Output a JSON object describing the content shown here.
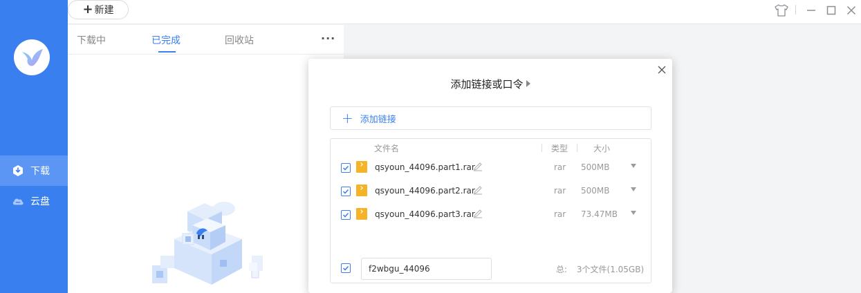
{
  "colors": {
    "accent": "#3a7ff0",
    "sidebar": "#3a7ff0",
    "folder_icon": "#f5b428"
  },
  "sidebar": {
    "logo_icon": "hummingbird-logo-icon",
    "items": [
      {
        "label": "下载",
        "icon": "download-icon",
        "active": true
      },
      {
        "label": "云盘",
        "icon": "cloud-icon",
        "active": false
      }
    ]
  },
  "toolbar": {
    "new_label": "新建",
    "icons": [
      "skin-icon",
      "minimize-icon",
      "maximize-icon",
      "close-icon"
    ]
  },
  "tabs": [
    {
      "label": "下载中",
      "active": false
    },
    {
      "label": "已完成",
      "active": true
    },
    {
      "label": "回收站",
      "active": false
    }
  ],
  "dialog": {
    "title": "添加链接或口令",
    "add_link_label": "添加链接",
    "headers": {
      "name": "文件名",
      "type": "类型",
      "size": "大小"
    },
    "files": [
      {
        "name": "qsyoun_44096.part1.rar",
        "type": "rar",
        "size": "500MB",
        "checked": true
      },
      {
        "name": "qsyoun_44096.part2.rar",
        "type": "rar",
        "size": "500MB",
        "checked": true
      },
      {
        "name": "qsyoun_44096.part3.rar",
        "type": "rar",
        "size": "73.47MB",
        "checked": true
      }
    ],
    "folder_name": "f2wbgu_44096",
    "total_label": "总:",
    "total_value": "3个文件(1.05GB)"
  }
}
